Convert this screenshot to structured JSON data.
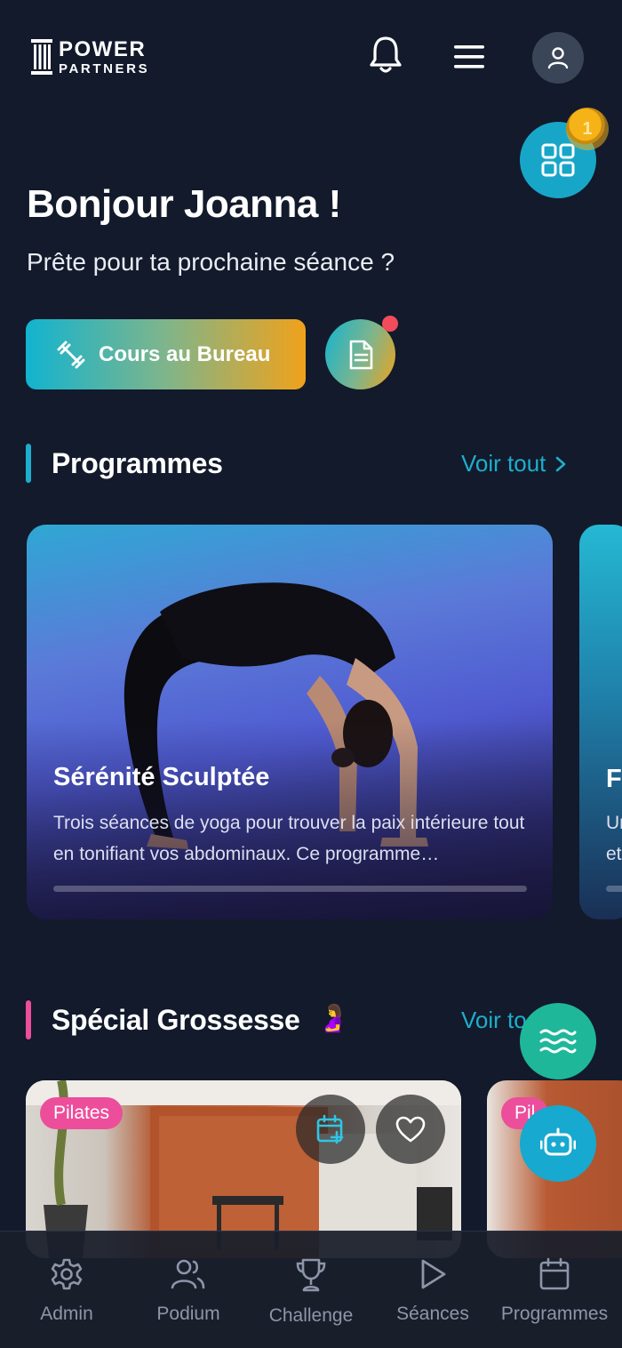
{
  "header": {
    "logo_line1": "POWER",
    "logo_line2": "PARTNERS",
    "coin_count": "1",
    "icons": [
      "bell-icon",
      "menu-icon",
      "user-icon",
      "grid-icon"
    ]
  },
  "greeting": {
    "title": "Bonjour Joanna !",
    "subtitle": "Prête pour ta prochaine séance ?"
  },
  "actions": {
    "cours_label": "Cours au Bureau",
    "cours_icon": "dumbbell-icon",
    "doc_icon": "document-icon"
  },
  "programmes": {
    "title": "Programmes",
    "see_all": "Voir tout",
    "cards": [
      {
        "title": "Sérénité Sculptée",
        "description": "Trois séances de yoga pour trouver la paix intérieure tout en tonifiant vos abdominaux. Ce programme…",
        "progress": 0
      },
      {
        "title": "F",
        "description": "Un et"
      }
    ]
  },
  "grossesse": {
    "title": "Spécial Grossesse",
    "emoji": "🤰",
    "see_all": "Voir to",
    "cards": [
      {
        "tag": "Pilates"
      },
      {
        "tag": "Pil"
      }
    ]
  },
  "tabbar": [
    {
      "label": "Admin",
      "icon": "gear-icon"
    },
    {
      "label": "Podium",
      "icon": "users-icon"
    },
    {
      "label": "Challenge",
      "icon": "trophy-icon"
    },
    {
      "label": "Séances",
      "icon": "play-icon"
    },
    {
      "label": "Programmes",
      "icon": "calendar-icon"
    }
  ],
  "colors": {
    "background": "#121a2b",
    "accent": "#1eaecd",
    "pink": "#ec4e9b",
    "gold": "#f0a21b"
  }
}
